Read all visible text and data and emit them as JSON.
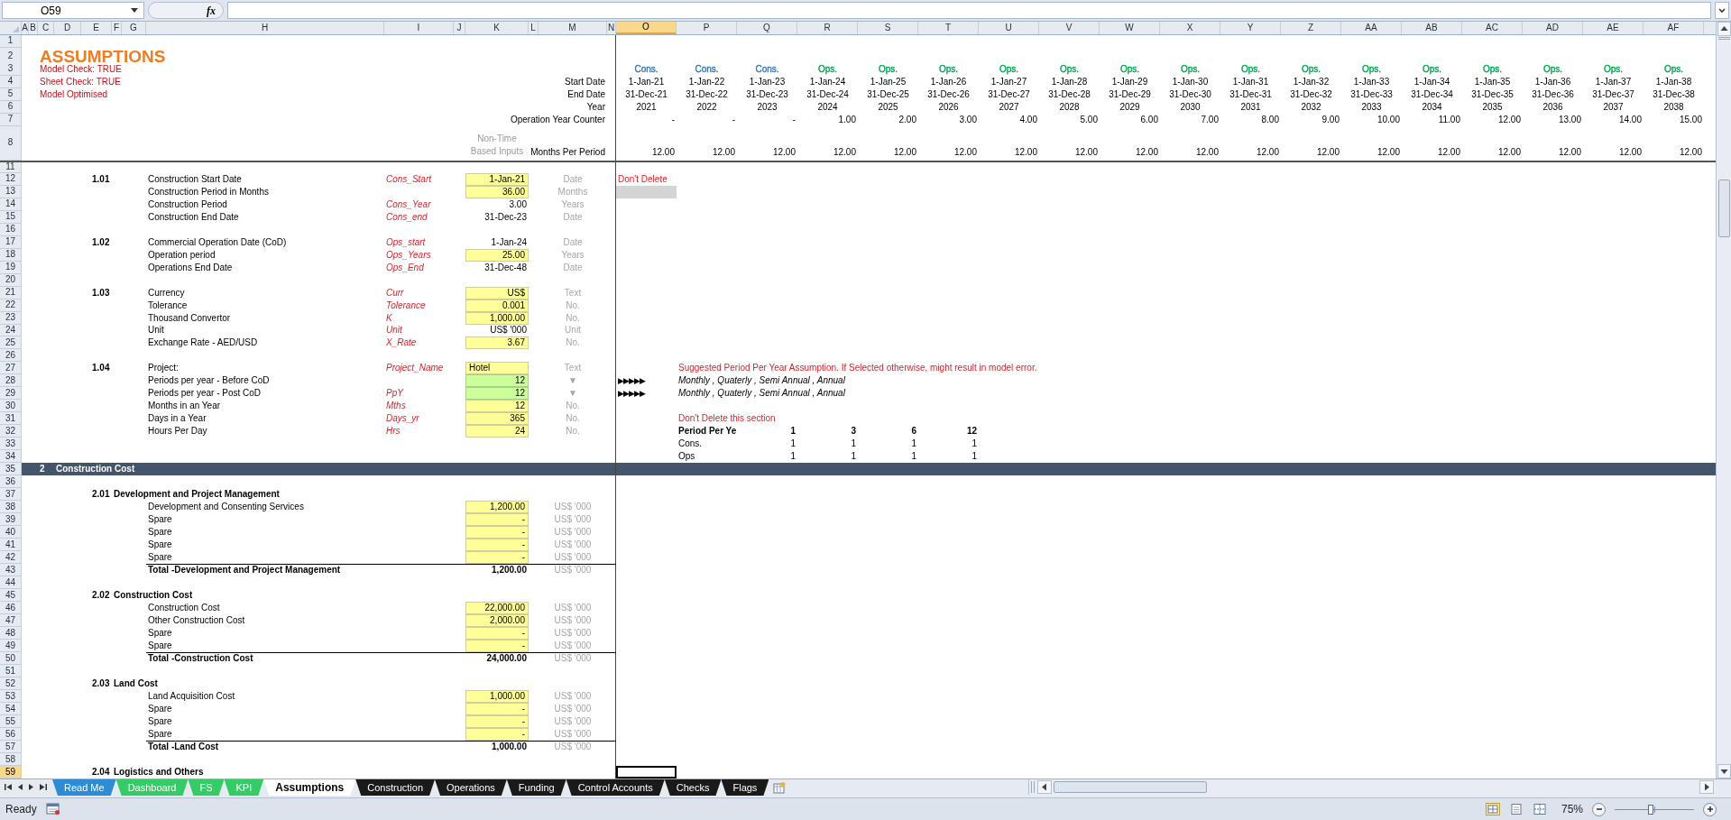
{
  "formula_bar": {
    "name_box": "O59",
    "function_label": "fx"
  },
  "columns": [
    {
      "letter": "A",
      "selected": false
    },
    {
      "letter": "B",
      "selected": false
    },
    {
      "letter": "C",
      "selected": false
    },
    {
      "letter": "D",
      "selected": false
    },
    {
      "letter": "E",
      "selected": false
    },
    {
      "letter": "F",
      "selected": false
    },
    {
      "letter": "G",
      "selected": false
    },
    {
      "letter": "H",
      "selected": false
    },
    {
      "letter": "I",
      "selected": false
    },
    {
      "letter": "J",
      "selected": false
    },
    {
      "letter": "K",
      "selected": false
    },
    {
      "letter": "L",
      "selected": false
    },
    {
      "letter": "M",
      "selected": false
    },
    {
      "letter": "N",
      "selected": false
    },
    {
      "letter": "O",
      "selected": true
    },
    {
      "letter": "P",
      "selected": false
    },
    {
      "letter": "Q",
      "selected": false
    },
    {
      "letter": "R",
      "selected": false
    },
    {
      "letter": "S",
      "selected": false
    },
    {
      "letter": "T",
      "selected": false
    },
    {
      "letter": "U",
      "selected": false
    },
    {
      "letter": "V",
      "selected": false
    },
    {
      "letter": "W",
      "selected": false
    },
    {
      "letter": "X",
      "selected": false
    },
    {
      "letter": "Y",
      "selected": false
    },
    {
      "letter": "Z",
      "selected": false
    },
    {
      "letter": "AA",
      "selected": false
    },
    {
      "letter": "AB",
      "selected": false
    },
    {
      "letter": "AC",
      "selected": false
    },
    {
      "letter": "AD",
      "selected": false
    },
    {
      "letter": "AE",
      "selected": false
    },
    {
      "letter": "AF",
      "selected": false
    }
  ],
  "top_rows": [
    {
      "number": "1",
      "selected": false
    },
    {
      "number": "2",
      "selected": false,
      "title": "ASSUMPTIONS"
    },
    {
      "number": "3",
      "selected": false,
      "check_note": "Model Check: TRUE"
    },
    {
      "number": "4",
      "selected": false,
      "check_note": "Sheet Check: TRUE",
      "caption": "Start Date"
    },
    {
      "number": "5",
      "selected": false,
      "check_note": "Model Optimised",
      "caption": "End Date"
    },
    {
      "number": "6",
      "selected": false,
      "caption": "Year"
    },
    {
      "number": "7",
      "selected": false,
      "caption": "Operation Year Counter"
    },
    {
      "number": "8",
      "selected": false,
      "note": "Non-Time Based Inputs",
      "caption": "Months Per Period"
    }
  ],
  "timeline": [
    {
      "color": "#2e75b6",
      "phase": "Cons.",
      "start": "1-Jan-21",
      "end": "31-Dec-21",
      "year": "2021",
      "counter": "-",
      "months": "12.00"
    },
    {
      "color": "#2e75b6",
      "phase": "Cons.",
      "start": "1-Jan-22",
      "end": "31-Dec-22",
      "year": "2022",
      "counter": "-",
      "months": "12.00"
    },
    {
      "color": "#2e75b6",
      "phase": "Cons.",
      "start": "1-Jan-23",
      "end": "31-Dec-23",
      "year": "2023",
      "counter": "-",
      "months": "12.00"
    },
    {
      "color": "#00a650",
      "phase": "Ops.",
      "start": "1-Jan-24",
      "end": "31-Dec-24",
      "year": "2024",
      "counter": "1.00",
      "months": "12.00"
    },
    {
      "color": "#00a650",
      "phase": "Ops.",
      "start": "1-Jan-25",
      "end": "31-Dec-25",
      "year": "2025",
      "counter": "2.00",
      "months": "12.00"
    },
    {
      "color": "#00a650",
      "phase": "Ops.",
      "start": "1-Jan-26",
      "end": "31-Dec-26",
      "year": "2026",
      "counter": "3.00",
      "months": "12.00"
    },
    {
      "color": "#00a650",
      "phase": "Ops.",
      "start": "1-Jan-27",
      "end": "31-Dec-27",
      "year": "2027",
      "counter": "4.00",
      "months": "12.00"
    },
    {
      "color": "#00a650",
      "phase": "Ops.",
      "start": "1-Jan-28",
      "end": "31-Dec-28",
      "year": "2028",
      "counter": "5.00",
      "months": "12.00"
    },
    {
      "color": "#00a650",
      "phase": "Ops.",
      "start": "1-Jan-29",
      "end": "31-Dec-29",
      "year": "2029",
      "counter": "6.00",
      "months": "12.00"
    },
    {
      "color": "#00a650",
      "phase": "Ops.",
      "start": "1-Jan-30",
      "end": "31-Dec-30",
      "year": "2030",
      "counter": "7.00",
      "months": "12.00"
    },
    {
      "color": "#00a650",
      "phase": "Ops.",
      "start": "1-Jan-31",
      "end": "31-Dec-31",
      "year": "2031",
      "counter": "8.00",
      "months": "12.00"
    },
    {
      "color": "#00a650",
      "phase": "Ops.",
      "start": "1-Jan-32",
      "end": "31-Dec-32",
      "year": "2032",
      "counter": "9.00",
      "months": "12.00"
    },
    {
      "color": "#00a650",
      "phase": "Ops.",
      "start": "1-Jan-33",
      "end": "31-Dec-33",
      "year": "2033",
      "counter": "10.00",
      "months": "12.00"
    },
    {
      "color": "#00a650",
      "phase": "Ops.",
      "start": "1-Jan-34",
      "end": "31-Dec-34",
      "year": "2034",
      "counter": "11.00",
      "months": "12.00"
    },
    {
      "color": "#00a650",
      "phase": "Ops.",
      "start": "1-Jan-35",
      "end": "31-Dec-35",
      "year": "2035",
      "counter": "12.00",
      "months": "12.00"
    },
    {
      "color": "#00a650",
      "phase": "Ops.",
      "start": "1-Jan-36",
      "end": "31-Dec-36",
      "year": "2036",
      "counter": "13.00",
      "months": "12.00"
    },
    {
      "color": "#00a650",
      "phase": "Ops.",
      "start": "1-Jan-37",
      "end": "31-Dec-37",
      "year": "2037",
      "counter": "14.00",
      "months": "12.00"
    },
    {
      "color": "#00a650",
      "phase": "Ops.",
      "start": "1-Jan-38",
      "end": "31-Dec-38",
      "year": "2038",
      "counter": "15.00",
      "months": "12.00"
    }
  ],
  "rows": [
    {
      "number": "11",
      "selected": false,
      "kind": "plain"
    },
    {
      "number": "12",
      "selected": false,
      "kind": "plain",
      "section_number": "1.01",
      "label": "Construction Start Date",
      "range_name": "Cons_Start",
      "value": {
        "text": "1-Jan-21",
        "kind": "input"
      },
      "unit": "Date",
      "side_flag": "Don't Delete"
    },
    {
      "number": "13",
      "selected": false,
      "kind": "plain",
      "label": "Construction Period in Months",
      "value": {
        "text": "36.00",
        "kind": "input"
      },
      "unit": "Months",
      "shaded_cell": true
    },
    {
      "number": "14",
      "selected": false,
      "kind": "plain",
      "label": "Construction Period",
      "range_name": "Cons_Year",
      "value": {
        "text": "3.00",
        "kind": "calc"
      },
      "unit": "Years"
    },
    {
      "number": "15",
      "selected": false,
      "kind": "plain",
      "label": "Construction End Date",
      "range_name": "Cons_end",
      "value": {
        "text": "31-Dec-23",
        "kind": "calc"
      },
      "unit": "Date"
    },
    {
      "number": "16",
      "selected": false,
      "kind": "plain"
    },
    {
      "number": "17",
      "selected": false,
      "kind": "plain",
      "section_number": "1.02",
      "label": "Commercial Operation Date (CoD)",
      "range_name": "Ops_start",
      "value": {
        "text": "1-Jan-24",
        "kind": "calc"
      },
      "unit": "Date"
    },
    {
      "number": "18",
      "selected": false,
      "kind": "plain",
      "label": "Operation period",
      "range_name": "Ops_Years",
      "value": {
        "text": "25.00",
        "kind": "input"
      },
      "unit": "Years"
    },
    {
      "number": "19",
      "selected": false,
      "kind": "plain",
      "label": "Operations End Date",
      "range_name": "Ops_End",
      "value": {
        "text": "31-Dec-48",
        "kind": "calc"
      },
      "unit": "Date"
    },
    {
      "number": "20",
      "selected": false,
      "kind": "plain"
    },
    {
      "number": "21",
      "selected": false,
      "kind": "plain",
      "section_number": "1.03",
      "label": "Currency",
      "range_name": "Curr",
      "value": {
        "text": "US$",
        "kind": "input"
      },
      "unit": "Text"
    },
    {
      "number": "22",
      "selected": false,
      "kind": "plain",
      "label": "Tolerance",
      "range_name": "Tolerance",
      "value": {
        "text": "0.001",
        "kind": "input"
      },
      "unit": "No."
    },
    {
      "number": "23",
      "selected": false,
      "kind": "plain",
      "label": "Thousand Convertor",
      "range_name": "K",
      "value": {
        "text": "1,000.00",
        "kind": "input"
      },
      "unit": "No."
    },
    {
      "number": "24",
      "selected": false,
      "kind": "plain",
      "label": "Unit",
      "range_name": "Unit",
      "value": {
        "text": "US$ '000",
        "kind": "calc"
      },
      "unit": "Unit"
    },
    {
      "number": "25",
      "selected": false,
      "kind": "plain",
      "label": "Exchange Rate - AED/USD",
      "range_name": "X_Rate",
      "value": {
        "text": "3.67",
        "kind": "input"
      },
      "unit": "No."
    },
    {
      "number": "26",
      "selected": false,
      "kind": "plain"
    },
    {
      "number": "27",
      "selected": false,
      "kind": "plain",
      "section_number": "1.04",
      "label": "Project:",
      "range_name": "Project_Name",
      "value": {
        "text": "Hotel",
        "kind": "text_input"
      },
      "unit": "Text",
      "side_note": {
        "text": "Suggested Period Per Year Assumption. If Selected otherwise, might result in model error.",
        "kind": "warning"
      }
    },
    {
      "number": "28",
      "selected": false,
      "kind": "plain",
      "label": "Periods per year - Before CoD",
      "value": {
        "text": "12",
        "kind": "dropdown"
      },
      "unit": "▼",
      "arrows": "▶▶▶▶▶",
      "side_note": {
        "text": "Monthly , Quaterly , Semi Annual , Annual",
        "kind": "italic"
      }
    },
    {
      "number": "29",
      "selected": false,
      "kind": "plain",
      "label": "Periods per year - Post CoD",
      "range_name": "PpY",
      "value": {
        "text": "12",
        "kind": "dropdown"
      },
      "unit": "▼",
      "arrows": "▶▶▶▶▶",
      "side_note": {
        "text": "Monthly , Quaterly , Semi Annual , Annual",
        "kind": "italic"
      }
    },
    {
      "number": "30",
      "selected": false,
      "kind": "plain",
      "label": "Months in an Year",
      "range_name": "Mths",
      "value": {
        "text": "12",
        "kind": "input"
      },
      "unit": "No."
    },
    {
      "number": "31",
      "selected": false,
      "kind": "plain",
      "label": "Days in a Year",
      "range_name": "Days_yr",
      "value": {
        "text": "365",
        "kind": "input"
      },
      "unit": "No.",
      "side_note": {
        "text": "Don't Delete this section",
        "kind": "warning"
      }
    },
    {
      "number": "32",
      "selected": false,
      "kind": "plain",
      "label": "Hours Per Day",
      "range_name": "Hrs",
      "value": {
        "text": "24",
        "kind": "input"
      },
      "unit": "No.",
      "side_note": {
        "text": "Period Per Ye",
        "kind": "header"
      },
      "period_values": [
        "1",
        "3",
        "6",
        "12"
      ]
    },
    {
      "number": "33",
      "selected": false,
      "kind": "plain",
      "side_note": {
        "text": "Cons.",
        "kind": "label"
      },
      "period_values": [
        "1",
        "1",
        "1",
        "1"
      ]
    },
    {
      "number": "34",
      "selected": false,
      "kind": "plain",
      "side_note": {
        "text": "Ops",
        "kind": "label"
      },
      "period_values": [
        "1",
        "1",
        "1",
        "1"
      ]
    },
    {
      "number": "35",
      "selected": false,
      "kind": "band",
      "band_number": "2",
      "band_title": "Construction Cost"
    },
    {
      "number": "36",
      "selected": false,
      "kind": "plain"
    },
    {
      "number": "37",
      "selected": false,
      "kind": "plain",
      "section_number": "2.01",
      "heading": "Development and Project Management"
    },
    {
      "number": "38",
      "selected": false,
      "kind": "plain",
      "label": "Development and Consenting Services",
      "value": {
        "text": "1,200.00",
        "kind": "input"
      },
      "unit": "US$ '000"
    },
    {
      "number": "39",
      "selected": false,
      "kind": "plain",
      "label": "Spare",
      "value": {
        "text": "-",
        "kind": "input"
      },
      "unit": "US$ '000"
    },
    {
      "number": "40",
      "selected": false,
      "kind": "plain",
      "label": "Spare",
      "value": {
        "text": "-",
        "kind": "input"
      },
      "unit": "US$ '000"
    },
    {
      "number": "41",
      "selected": false,
      "kind": "plain",
      "label": "Spare",
      "value": {
        "text": "-",
        "kind": "input"
      },
      "unit": "US$ '000"
    },
    {
      "number": "42",
      "selected": false,
      "kind": "plain",
      "label": "Spare",
      "value": {
        "text": "-",
        "kind": "input"
      },
      "unit": "US$ '000"
    },
    {
      "number": "43",
      "selected": false,
      "kind": "total",
      "label": "Total -Development and Project Management",
      "value": {
        "text": "1,200.00",
        "kind": "total"
      },
      "unit": "US$ '000"
    },
    {
      "number": "44",
      "selected": false,
      "kind": "plain"
    },
    {
      "number": "45",
      "selected": false,
      "kind": "plain",
      "section_number": "2.02",
      "heading": "Construction Cost"
    },
    {
      "number": "46",
      "selected": false,
      "kind": "plain",
      "label": "Construction Cost",
      "value": {
        "text": "22,000.00",
        "kind": "input"
      },
      "unit": "US$ '000"
    },
    {
      "number": "47",
      "selected": false,
      "kind": "plain",
      "label": "Other Construction Cost",
      "value": {
        "text": "2,000.00",
        "kind": "input"
      },
      "unit": "US$ '000"
    },
    {
      "number": "48",
      "selected": false,
      "kind": "plain",
      "label": "Spare",
      "value": {
        "text": "-",
        "kind": "input"
      },
      "unit": "US$ '000"
    },
    {
      "number": "49",
      "selected": false,
      "kind": "plain",
      "label": "Spare",
      "value": {
        "text": "-",
        "kind": "input"
      },
      "unit": "US$ '000"
    },
    {
      "number": "50",
      "selected": false,
      "kind": "total",
      "label": "Total -Construction Cost",
      "value": {
        "text": "24,000.00",
        "kind": "total"
      },
      "unit": "US$ '000"
    },
    {
      "number": "51",
      "selected": false,
      "kind": "plain"
    },
    {
      "number": "52",
      "selected": false,
      "kind": "plain",
      "section_number": "2.03",
      "heading": "Land Cost"
    },
    {
      "number": "53",
      "selected": false,
      "kind": "plain",
      "label": "Land Acquisition Cost",
      "value": {
        "text": "1,000.00",
        "kind": "input"
      },
      "unit": "US$ '000"
    },
    {
      "number": "54",
      "selected": false,
      "kind": "plain",
      "label": "Spare",
      "value": {
        "text": "-",
        "kind": "input"
      },
      "unit": "US$ '000"
    },
    {
      "number": "55",
      "selected": false,
      "kind": "plain",
      "label": "Spare",
      "value": {
        "text": "-",
        "kind": "input"
      },
      "unit": "US$ '000"
    },
    {
      "number": "56",
      "selected": false,
      "kind": "plain",
      "label": "Spare",
      "value": {
        "text": "-",
        "kind": "input"
      },
      "unit": "US$ '000"
    },
    {
      "number": "57",
      "selected": false,
      "kind": "total",
      "label": "Total -Land Cost",
      "value": {
        "text": "1,000.00",
        "kind": "total"
      },
      "unit": "US$ '000"
    },
    {
      "number": "58",
      "selected": false,
      "kind": "plain"
    },
    {
      "number": "59",
      "selected": true,
      "kind": "plain",
      "section_number": "2.04",
      "heading": "Logistics and Others",
      "active_cell": true
    }
  ],
  "sheet_tabs": [
    {
      "label": "Read Me",
      "selected": false,
      "color": "#2e8bd6"
    },
    {
      "label": "Dashboard",
      "selected": false,
      "color": "#33cc66"
    },
    {
      "label": "FS",
      "selected": false,
      "color": "#33cc66"
    },
    {
      "label": "KPI",
      "selected": false,
      "color": "#33cc66"
    },
    {
      "label": "Assumptions",
      "selected": true
    },
    {
      "label": "Construction",
      "selected": false,
      "color": "#1a1a1a"
    },
    {
      "label": "Operations",
      "selected": false,
      "color": "#1a1a1a"
    },
    {
      "label": "Funding",
      "selected": false,
      "color": "#1a1a1a"
    },
    {
      "label": "Control Accounts",
      "selected": false,
      "color": "#1a1a1a"
    },
    {
      "label": "Checks",
      "selected": false,
      "color": "#1a1a1a"
    },
    {
      "label": "Flags",
      "selected": false,
      "color": "#1a1a1a"
    }
  ],
  "status_bar": {
    "status": "Ready",
    "zoom": "75%",
    "zoom_slider": {
      "level": 0.45
    }
  }
}
